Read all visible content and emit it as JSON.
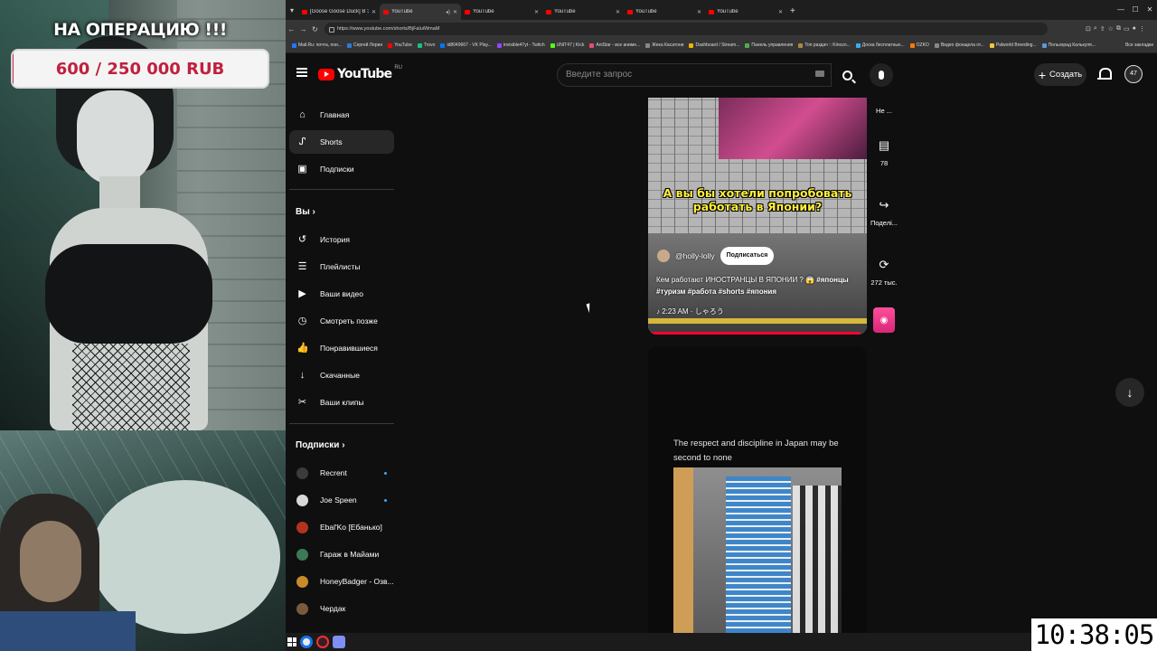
{
  "overlay": {
    "banner_title": "НА ОПЕРАЦИЮ !!!",
    "goal_text": "600 / 250 000 RUB",
    "goal_progress_fraction": 0.0024
  },
  "browser": {
    "tabs": [
      {
        "title": "[Goose Goose Duck] В ЭТОМ",
        "active": false
      },
      {
        "title": "YouTube",
        "active": true
      },
      {
        "title": "YouTube",
        "active": false
      },
      {
        "title": "YouTube",
        "active": false
      },
      {
        "title": "YouTube",
        "active": false
      },
      {
        "title": "YouTube",
        "active": false
      }
    ],
    "new_tab": "+",
    "url": "https://www.youtube.com/shorts/BjFaluiWmaM",
    "bookmarks": [
      {
        "label": "Mail.Ru: почта, пои...",
        "color": "#1e78ff"
      },
      {
        "label": "Сергей Лерин",
        "color": "#2d7bd6"
      },
      {
        "label": "YouTube",
        "color": "#ff0000"
      },
      {
        "label": "Trovo",
        "color": "#19c37d"
      },
      {
        "label": "id8049667 - VK Play...",
        "color": "#0077ff"
      },
      {
        "label": "invisible47yt - Twitch",
        "color": "#9146ff"
      },
      {
        "label": "UNIT47 | Kick",
        "color": "#53fc18"
      },
      {
        "label": "AniStar - все аниме...",
        "color": "#e94b6b"
      },
      {
        "label": "Жека Касатони",
        "color": "#888888"
      },
      {
        "label": "Dashboard / Stream...",
        "color": "#f0b400"
      },
      {
        "label": "Панель управления",
        "color": "#4caf50"
      },
      {
        "label": "Топ раздач :: Kinozo...",
        "color": "#aa8844"
      },
      {
        "label": "Доска бесплатных...",
        "color": "#3fa9f5"
      },
      {
        "label": "OZKO",
        "color": "#ff7a00"
      },
      {
        "label": "Видео фонщела от...",
        "color": "#888888"
      },
      {
        "label": "Palworld Breeding...",
        "color": "#f4c542"
      },
      {
        "label": "Пользорад Калькуля...",
        "color": "#5b9bd5"
      }
    ],
    "bookmarks_all": "Все закладки"
  },
  "youtube": {
    "logo_text": "YouTube",
    "country_code": "RU",
    "search_placeholder": "Введите запрос",
    "create_label": "Создать",
    "avatar_text": "47",
    "sidebar": {
      "main": [
        {
          "label": "Главная",
          "icon": "home-icon"
        },
        {
          "label": "Shorts",
          "icon": "shorts-icon",
          "active": true
        },
        {
          "label": "Подписки",
          "icon": "subscriptions-icon"
        }
      ],
      "you_header": "Вы",
      "you": [
        {
          "label": "История",
          "icon": "history-icon"
        },
        {
          "label": "Плейлисты",
          "icon": "playlists-icon"
        },
        {
          "label": "Ваши видео",
          "icon": "your-videos-icon"
        },
        {
          "label": "Смотреть позже",
          "icon": "watch-later-icon"
        },
        {
          "label": "Понравившиеся",
          "icon": "like-icon"
        },
        {
          "label": "Скачанные",
          "icon": "download-icon"
        },
        {
          "label": "Ваши клипы",
          "icon": "clips-icon"
        }
      ],
      "subs_header": "Подписки",
      "subs": [
        {
          "label": "Recrent",
          "color": "#3c3c3c",
          "new": true
        },
        {
          "label": "Joe Speen",
          "color": "#d8d8d8",
          "new": true
        },
        {
          "label": "Ebal'Ko [Ебанько]",
          "color": "#b3331f",
          "new": false
        },
        {
          "label": "Гараж в Майами",
          "color": "#3b7a55",
          "new": false
        },
        {
          "label": "HoneyBadger - Озв...",
          "color": "#c98a2b",
          "new": false
        },
        {
          "label": "Чердак",
          "color": "#7a5a3c",
          "new": false
        }
      ]
    },
    "short1": {
      "caption": "А вы бы хотели попробовать работать в Японии?",
      "channel": "@holly-lolly",
      "subscribe_label": "Подписаться",
      "title": "Кем работают ИНОСТРАНЦЫ В ЯПОНИИ ? 😱",
      "hashtags": "#японцы #туризм #работа #shorts #япония",
      "music": "2:23 AM · しゃろう",
      "progress_fraction": 0.97
    },
    "actions": {
      "dislike_label": "Не ...",
      "comments_count": "78",
      "share_label": "Поделі...",
      "remix_count": "272 тыс."
    },
    "short2": {
      "text": "The respect and discipline in Japan may be second to none"
    }
  },
  "clock": "10:38:05"
}
